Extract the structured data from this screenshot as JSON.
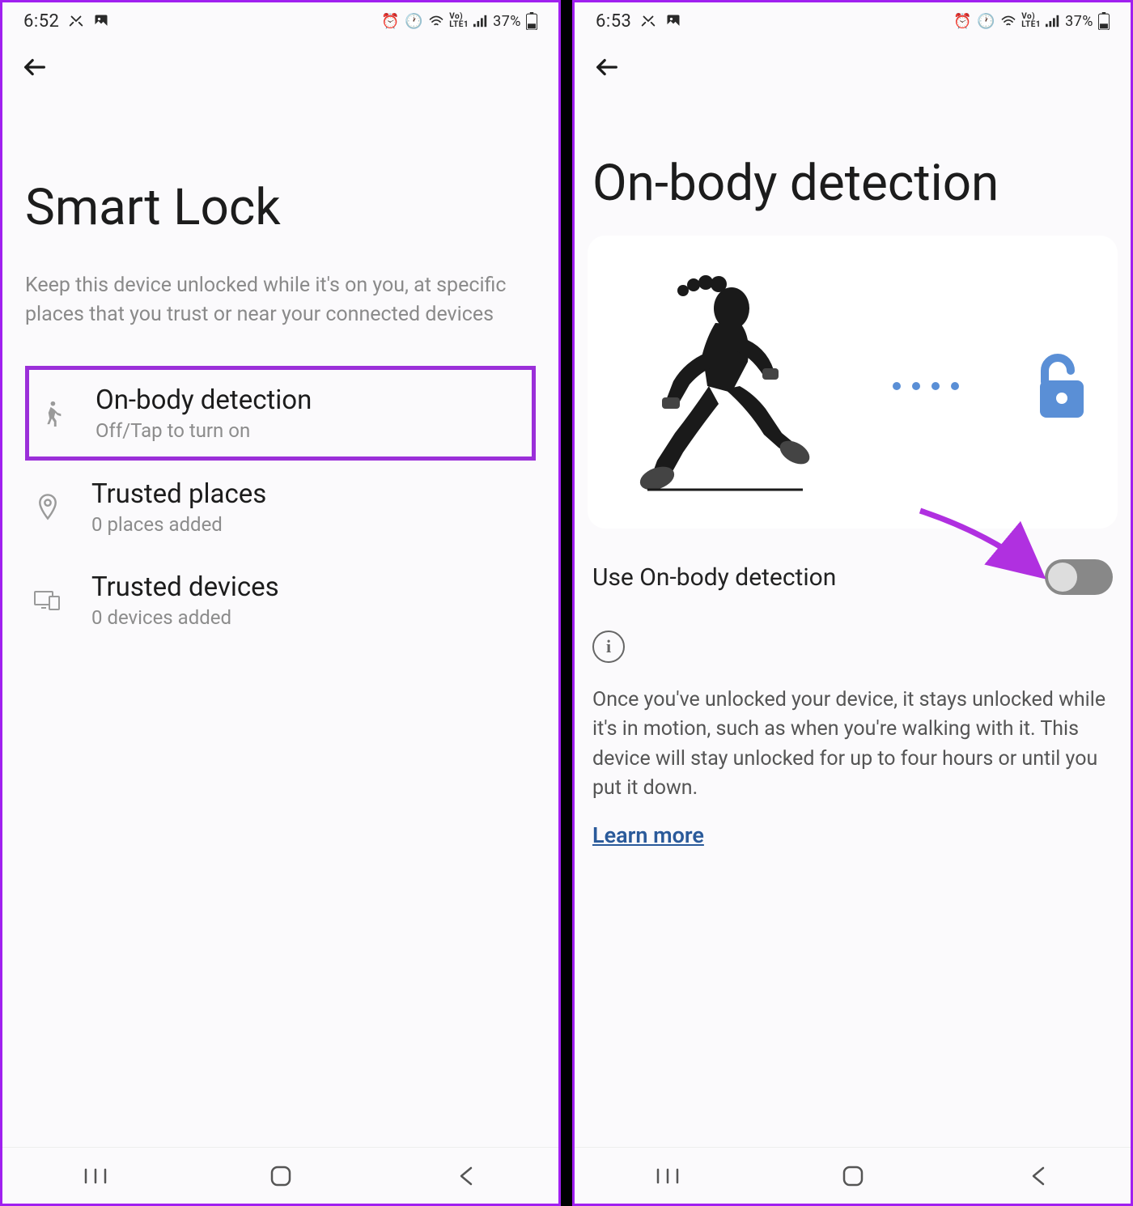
{
  "left": {
    "statusbar": {
      "time": "6:52",
      "battery": "37%"
    },
    "title": "Smart Lock",
    "subtitle": "Keep this device unlocked while it's on you, at specific places that you trust or near your connected devices",
    "rows": [
      {
        "title": "On-body detection",
        "sub": "Off/Tap to turn on"
      },
      {
        "title": "Trusted places",
        "sub": "0 places added"
      },
      {
        "title": "Trusted devices",
        "sub": "0 devices added"
      }
    ]
  },
  "right": {
    "statusbar": {
      "time": "6:53",
      "battery": "37%"
    },
    "title": "On-body detection",
    "toggle_label": "Use On-body detection",
    "info_body": "Once you've unlocked your device, it stays un­locked while it's in motion, such as when you're walking with it. This device will stay unlocked for up to four hours or until you put it down.",
    "learn_more": "Learn more"
  }
}
